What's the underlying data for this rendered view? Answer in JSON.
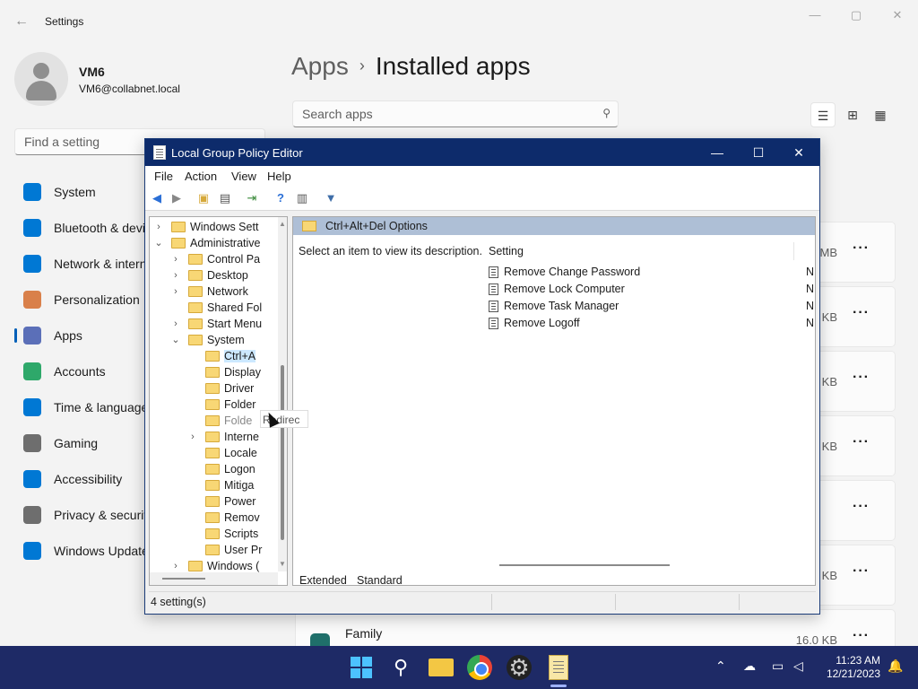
{
  "settings": {
    "title": "Settings",
    "user": {
      "name": "VM6",
      "email": "VM6@collabnet.local"
    },
    "find_placeholder": "Find a setting",
    "nav": [
      {
        "label": "System",
        "icon": "monitor-icon"
      },
      {
        "label": "Bluetooth & devices",
        "icon": "bluetooth-icon"
      },
      {
        "label": "Network & internet",
        "icon": "wifi-icon"
      },
      {
        "label": "Personalization",
        "icon": "brush-icon"
      },
      {
        "label": "Apps",
        "icon": "apps-icon",
        "active": true
      },
      {
        "label": "Accounts",
        "icon": "person-icon"
      },
      {
        "label": "Time & language",
        "icon": "globe-clock-icon"
      },
      {
        "label": "Gaming",
        "icon": "controller-icon"
      },
      {
        "label": "Accessibility",
        "icon": "accessibility-icon"
      },
      {
        "label": "Privacy & security",
        "icon": "shield-icon"
      },
      {
        "label": "Windows Update",
        "icon": "update-icon"
      }
    ],
    "breadcrumb": {
      "parent": "Apps",
      "sep": "›",
      "current": "Installed apps"
    },
    "search_placeholder": "Search apps",
    "app_rows": [
      {
        "size": "MB"
      },
      {
        "size": "KB"
      },
      {
        "size": "KB"
      },
      {
        "size": "KB"
      },
      {
        "size": ""
      },
      {
        "size": "KB"
      },
      {
        "name": "Family",
        "size": "16.0 KB"
      }
    ],
    "more": "···"
  },
  "gpe": {
    "title": "Local Group Policy Editor",
    "menu": [
      "File",
      "Action",
      "View",
      "Help"
    ],
    "tree": [
      {
        "label": "Windows Sett",
        "arrow": "›"
      },
      {
        "label": "Administrative",
        "arrow": "⌄"
      },
      {
        "label": "Control Pa",
        "arrow": "›"
      },
      {
        "label": "Desktop",
        "arrow": "›"
      },
      {
        "label": "Network",
        "arrow": "›"
      },
      {
        "label": "Shared Fol",
        "arrow": ""
      },
      {
        "label": "Start Menu",
        "arrow": "›"
      },
      {
        "label": "System",
        "arrow": "⌄"
      },
      {
        "label": "Ctrl+A",
        "arrow": "",
        "selected": true
      },
      {
        "label": "Display",
        "arrow": ""
      },
      {
        "label": "Driver",
        "arrow": ""
      },
      {
        "label": "Folder",
        "arrow": ""
      },
      {
        "label": "Folde",
        "arrow": ""
      },
      {
        "label": "Interne",
        "arrow": "›"
      },
      {
        "label": "Locale",
        "arrow": ""
      },
      {
        "label": "Logon",
        "arrow": ""
      },
      {
        "label": "Mitiga",
        "arrow": ""
      },
      {
        "label": "Power",
        "arrow": ""
      },
      {
        "label": "Remov",
        "arrow": ""
      },
      {
        "label": "Scripts",
        "arrow": ""
      },
      {
        "label": "User Pr",
        "arrow": ""
      },
      {
        "label": "Windows (",
        "arrow": "›"
      }
    ],
    "tooltip": "Redirec",
    "header": "Ctrl+Alt+Del Options",
    "description": "Select an item to view its description.",
    "column_setting": "Setting",
    "settings": [
      {
        "name": "Remove Change Password",
        "state": "N"
      },
      {
        "name": "Remove Lock Computer",
        "state": "N"
      },
      {
        "name": "Remove Task Manager",
        "state": "N"
      },
      {
        "name": "Remove Logoff",
        "state": "N"
      }
    ],
    "tabs": [
      "Extended",
      "Standard"
    ],
    "status": "4 setting(s)"
  },
  "taskbar": {
    "time": "11:23 AM",
    "date": "12/21/2023"
  }
}
